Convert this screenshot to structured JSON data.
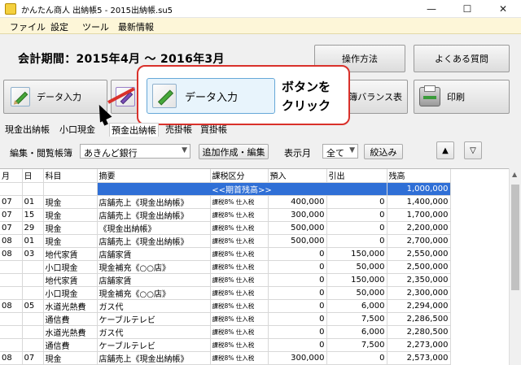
{
  "window": {
    "title": "かんたん商人 出納帳5 - 2015出納帳.su5",
    "minimize": "—",
    "maximize": "☐",
    "close": "✕"
  },
  "menu": [
    "ファイル",
    "設定",
    "ツール",
    "最新情報"
  ],
  "period": "会計期間：2015年4月 〜 2016年3月",
  "buttons": {
    "howto": "操作方法",
    "faq": "よくある質問",
    "data_entry": "データ入力",
    "balance": "簿バランス表",
    "print": "印刷"
  },
  "callout": {
    "button_label": "データ入力",
    "text_line1": "ボタンを",
    "text_line2": "クリック"
  },
  "tabs": [
    "現金出納帳",
    "小口現金",
    "預金出納帳",
    "売掛帳",
    "買掛帳"
  ],
  "toolbar": {
    "ledger_label": "編集・閲覧帳簿",
    "ledger_value": "あきんど銀行",
    "add_button": "追加作成・編集",
    "month_label": "表示月",
    "month_value": "全て",
    "filter_button": "絞込み",
    "up_button": "▲",
    "down_button": "▽"
  },
  "table": {
    "headers": [
      "月",
      "日",
      "科目",
      "摘要",
      "課税区分",
      "預入",
      "引出",
      "残高"
    ],
    "opening": {
      "label": "<<期首残高>>",
      "balance": "1,000,000"
    },
    "rows": [
      [
        "07",
        "01",
        "現金",
        "店舗売上《現金出納帳》",
        "課税8% 仕入税",
        "400,000",
        "0",
        "1,400,000"
      ],
      [
        "07",
        "15",
        "現金",
        "店舗売上《現金出納帳》",
        "課税8% 仕入税",
        "300,000",
        "0",
        "1,700,000"
      ],
      [
        "07",
        "29",
        "現金",
        "《現金出納帳》",
        "課税8% 仕入税",
        "500,000",
        "0",
        "2,200,000"
      ],
      [
        "08",
        "01",
        "現金",
        "店舗売上《現金出納帳》",
        "課税8% 仕入税",
        "500,000",
        "0",
        "2,700,000"
      ],
      [
        "08",
        "03",
        "地代家賃",
        "店舗家賃",
        "課税8% 仕入税",
        "0",
        "150,000",
        "2,550,000"
      ],
      [
        "",
        "",
        "小口現金",
        "現金補充《○○店》",
        "課税8% 仕入税",
        "0",
        "50,000",
        "2,500,000"
      ],
      [
        "",
        "",
        "地代家賃",
        "店舗家賃",
        "課税8% 仕入税",
        "0",
        "150,000",
        "2,350,000"
      ],
      [
        "",
        "",
        "小口現金",
        "現金補充《○○店》",
        "課税8% 仕入税",
        "0",
        "50,000",
        "2,300,000"
      ],
      [
        "08",
        "05",
        "水道光熱費",
        "ガス代",
        "課税8% 仕入税",
        "0",
        "6,000",
        "2,294,000"
      ],
      [
        "",
        "",
        "通信費",
        "ケーブルテレビ",
        "課税8% 仕入税",
        "0",
        "7,500",
        "2,286,500"
      ],
      [
        "",
        "",
        "水道光熱費",
        "ガス代",
        "課税8% 仕入税",
        "0",
        "6,000",
        "2,280,500"
      ],
      [
        "",
        "",
        "通信費",
        "ケーブルテレビ",
        "課税8% 仕入税",
        "0",
        "7,500",
        "2,273,000"
      ],
      [
        "08",
        "07",
        "現金",
        "店舗売上《現金出納帳》",
        "課税8% 仕入税",
        "300,000",
        "0",
        "2,573,000"
      ]
    ]
  }
}
